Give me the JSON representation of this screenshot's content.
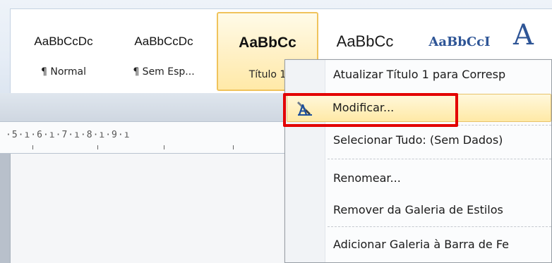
{
  "ribbon": {
    "styles": [
      {
        "sample": "AaBbCcDc",
        "name": "¶ Normal"
      },
      {
        "sample": "AaBbCcDc",
        "name": "¶ Sem Esp..."
      },
      {
        "sample": "AaBbCc",
        "name": "Título 1",
        "selected": true
      },
      {
        "sample": "AaBbCc",
        "name": ""
      },
      {
        "sample": "AaBbCcI",
        "name": ""
      },
      {
        "sample": "A",
        "name": ""
      }
    ]
  },
  "ruler": {
    "text": "·5·ı·6·ı·7·ı·8·ı·9·ı"
  },
  "context_menu": {
    "items": [
      {
        "label": "Atualizar Título 1 para Corresp",
        "underline": "A"
      },
      {
        "label": "Modificar...",
        "underline": "M",
        "highlighted": true,
        "icon": "modify-style-icon"
      },
      {
        "label": "Selecionar Tudo: (Sem Dados)"
      },
      {
        "label": "Renomear...",
        "underline": "n"
      },
      {
        "label": "Remover da Galeria de Estilos",
        "underline": ""
      },
      {
        "label": "Adicionar Galeria à Barra de Fe",
        "underline": "G"
      }
    ]
  },
  "colors": {
    "highlight_border": "#e30000",
    "selected_tile_border": "#f0c35c",
    "heading_blue": "#2e5596"
  }
}
